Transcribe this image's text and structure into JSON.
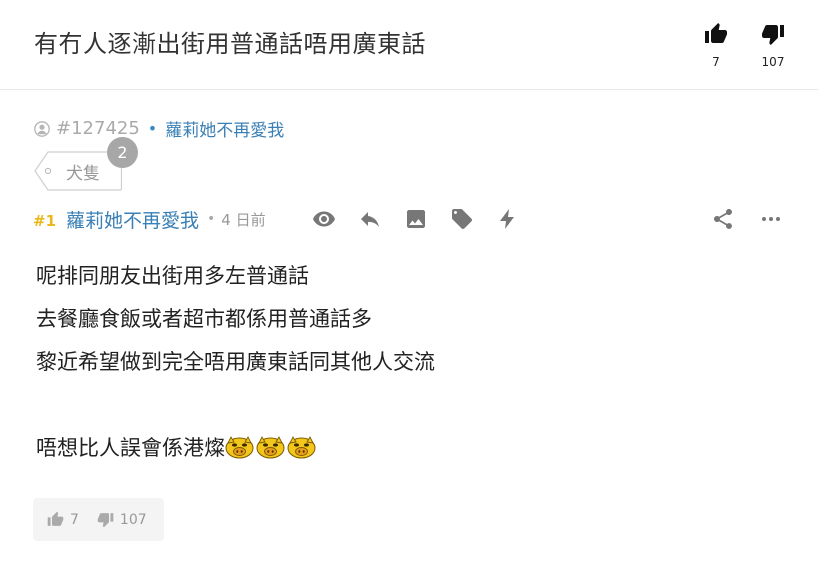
{
  "thread": {
    "title": "有冇人逐漸出街用普通話唔用廣東話",
    "upvotes": "7",
    "downvotes": "107",
    "id": "#127425",
    "author": "蘿莉她不再愛我",
    "tag": "犬隻",
    "tag_count": "2"
  },
  "reply": {
    "floor": "#1",
    "author": "蘿莉她不再愛我",
    "time": "4 日前",
    "lines": [
      "呢排同朋友出街用多左普通話",
      "去餐廳食飯或者超市都係用普通話多",
      "黎近希望做到完全唔用廣東話同其他人交流",
      "",
      "唔想比人誤會係港燦"
    ],
    "emoji_count": 3,
    "upvotes": "7",
    "downvotes": "107"
  },
  "colors": {
    "accent_blue": "#3a7fb5",
    "floor_yellow": "#e8b81c",
    "muted": "#999999",
    "icon": "#777777"
  },
  "icons": {
    "upvote": "thumbs-up-icon",
    "downvote": "thumbs-down-icon",
    "user": "user-icon",
    "view": "eye-icon",
    "reply": "reply-icon",
    "image": "image-icon",
    "tag": "tag-icon",
    "quick": "lightning-icon",
    "share": "share-icon",
    "more": "more-icon"
  }
}
